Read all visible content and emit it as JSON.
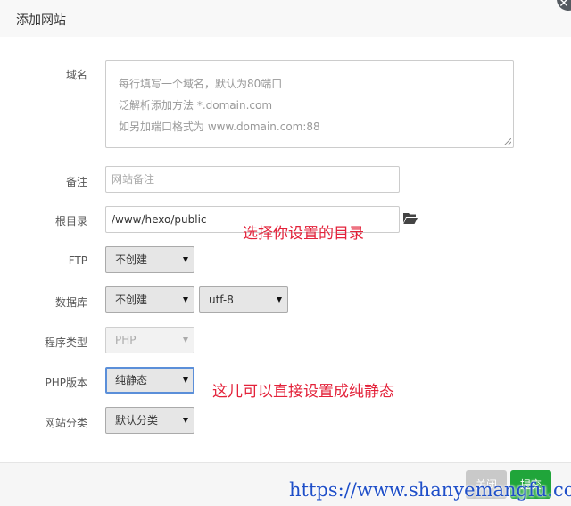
{
  "dialog": {
    "title": "添加网站"
  },
  "form": {
    "domain": {
      "label": "域名",
      "placeholder_lines": [
        "每行填写一个域名，默认为80端口",
        "泛解析添加方法 *.domain.com",
        "如另加端口格式为 www.domain.com:88"
      ]
    },
    "note": {
      "label": "备注",
      "placeholder": "网站备注"
    },
    "root": {
      "label": "根目录",
      "value": "/www/hexo/public",
      "icon": "folder-open-icon"
    },
    "ftp": {
      "label": "FTP",
      "selected": "不创建"
    },
    "database": {
      "label": "数据库",
      "selected": "不创建",
      "charset": "utf-8"
    },
    "program_type": {
      "label": "程序类型",
      "selected": "PHP"
    },
    "php_version": {
      "label": "PHP版本",
      "selected": "纯静态"
    },
    "category": {
      "label": "网站分类",
      "selected": "默认分类"
    }
  },
  "annotations": {
    "root_hint": "选择你设置的目录",
    "php_hint": "这儿可以直接设置成纯静态"
  },
  "footer": {
    "close_label": "关闭",
    "submit_label": "提交"
  },
  "watermark": "https://www.shanyemangfu.com",
  "colors": {
    "submit": "#20a53a",
    "annotation": "#e3223a",
    "watermark": "#1f4fc8"
  }
}
